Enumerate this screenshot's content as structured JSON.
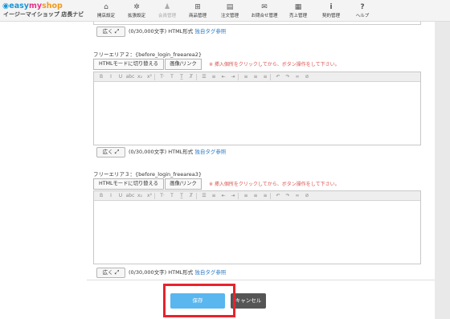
{
  "header": {
    "logo": {
      "mark": "◉",
      "easy": "easy",
      "my": "my",
      "shop": "shop",
      "subtitle": "イージーマイショップ 店長ナビ"
    },
    "nav": [
      {
        "icon": "home-icon",
        "glyph": "⌂",
        "label": "開店設定"
      },
      {
        "icon": "gear-icon",
        "glyph": "✲",
        "label": "拡張設定"
      },
      {
        "icon": "user-icon",
        "glyph": "♟",
        "label": "会員管理"
      },
      {
        "icon": "gift-icon",
        "glyph": "⊞",
        "label": "商品管理"
      },
      {
        "icon": "document-icon",
        "glyph": "▤",
        "label": "注文管理"
      },
      {
        "icon": "mail-icon",
        "glyph": "✉",
        "label": "お問合せ管理"
      },
      {
        "icon": "calculator-icon",
        "glyph": "▦",
        "label": "売上管理"
      },
      {
        "icon": "info-icon",
        "glyph": "i",
        "label": "契約管理"
      },
      {
        "icon": "help-icon",
        "glyph": "?",
        "label": "ヘルプ"
      }
    ]
  },
  "section1": {
    "expand_label": "広く",
    "info": "(0/30,000文字) HTML形式",
    "link": "独自タグ参照"
  },
  "section2": {
    "label": "フリーエリア２：{before_login_freearea2}",
    "html_button": "HTMLモードに切り替える",
    "image_button": "画像/リンク",
    "note": "※ 挿入個所をクリックしてから、ボタン操作をして下さい。",
    "expand_label": "広く",
    "info": "(0/30,000文字) HTML形式",
    "link": "独自タグ参照"
  },
  "section3": {
    "label": "フリーエリア３：{before_login_freearea3}",
    "html_button": "HTMLモードに切り替える",
    "image_button": "画像/リンク",
    "note": "※ 挿入個所をクリックしてから、ボタン操作をして下さい。",
    "expand_label": "広く",
    "info": "(0/30,000文字) HTML形式",
    "link": "独自タグ参照"
  },
  "toolbar_buttons": [
    {
      "name": "bold-icon",
      "glyph": "B"
    },
    {
      "name": "italic-icon",
      "glyph": "I"
    },
    {
      "name": "underline-icon",
      "glyph": "U"
    },
    {
      "name": "strikethrough-icon",
      "glyph": "abc"
    },
    {
      "name": "subscript-icon",
      "glyph": "x₂"
    },
    {
      "name": "superscript-icon",
      "glyph": "x²"
    },
    {
      "name": "separator",
      "glyph": ""
    },
    {
      "name": "font-size-icon",
      "glyph": "T·"
    },
    {
      "name": "text-color-icon",
      "glyph": "T"
    },
    {
      "name": "background-color-icon",
      "glyph": "T̲"
    },
    {
      "name": "clear-format-icon",
      "glyph": "T̸"
    },
    {
      "name": "separator",
      "glyph": ""
    },
    {
      "name": "bullet-list-icon",
      "glyph": "☰"
    },
    {
      "name": "numbered-list-icon",
      "glyph": "≡"
    },
    {
      "name": "outdent-icon",
      "glyph": "⇤"
    },
    {
      "name": "indent-icon",
      "glyph": "⇥"
    },
    {
      "name": "separator",
      "glyph": ""
    },
    {
      "name": "align-left-icon",
      "glyph": "≡"
    },
    {
      "name": "align-center-icon",
      "glyph": "≡"
    },
    {
      "name": "align-right-icon",
      "glyph": "≡"
    },
    {
      "name": "separator",
      "glyph": ""
    },
    {
      "name": "undo-icon",
      "glyph": "↶"
    },
    {
      "name": "redo-icon",
      "glyph": "↷"
    },
    {
      "name": "link-icon",
      "glyph": "∞"
    },
    {
      "name": "unlink-icon",
      "glyph": "⊘"
    }
  ],
  "actions": {
    "save": "保存",
    "cancel": "キャンセル"
  }
}
